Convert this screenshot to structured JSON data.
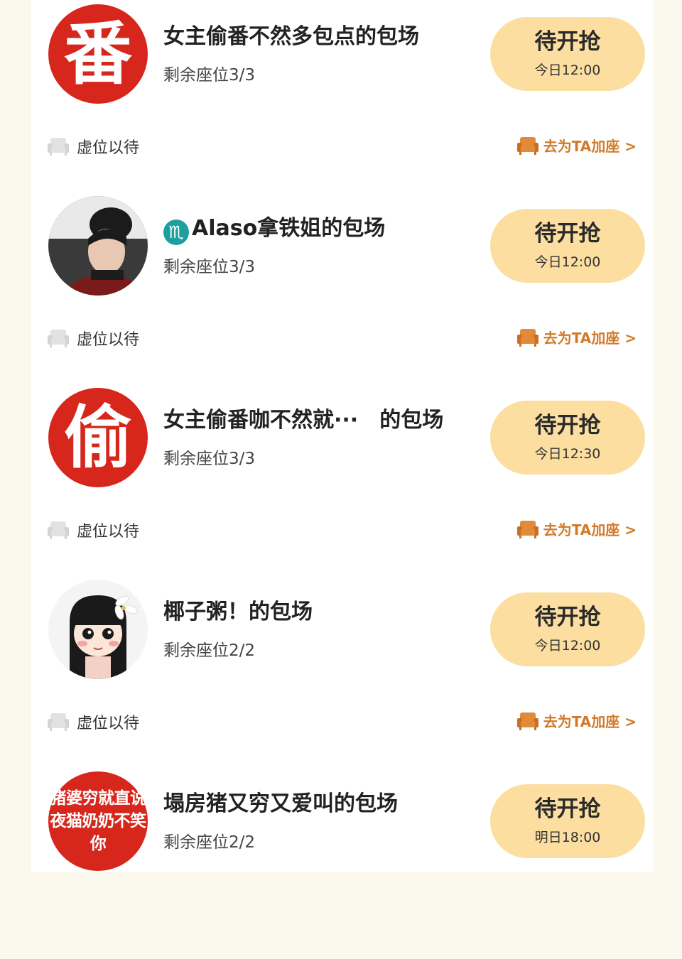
{
  "colors": {
    "accent_orange": "#d07a2a",
    "button_bg": "#fcdea0",
    "avatar_red": "#d7261c"
  },
  "sessions": [
    {
      "avatar_char": "番",
      "title": "女主偷番不然多包点的包场",
      "seats": "剩余座位3/3",
      "button_label": "待开抢",
      "button_time": "今日12:00",
      "vacant_label": "虚位以待",
      "add_label": "去为TA加座 >"
    },
    {
      "avatar_icon": "portrait-photo",
      "title_badge": "♏",
      "title": "Alaso拿铁姐的包场",
      "seats": "剩余座位3/3",
      "button_label": "待开抢",
      "button_time": "今日12:00",
      "vacant_label": "虚位以待",
      "add_label": "去为TA加座 >"
    },
    {
      "avatar_char": "偷",
      "title": "女主偷番咖不然就···　的包场",
      "seats": "剩余座位3/3",
      "button_label": "待开抢",
      "button_time": "今日12:30",
      "vacant_label": "虚位以待",
      "add_label": "去为TA加座 >"
    },
    {
      "avatar_icon": "cartoon-girl",
      "title": "椰子粥！的包场",
      "seats": "剩余座位2/2",
      "button_label": "待开抢",
      "button_time": "今日12:00",
      "vacant_label": "虚位以待",
      "add_label": "去为TA加座 >"
    },
    {
      "avatar_text_lines": [
        "猪婆穷就直说",
        "夜猫奶奶不笑你"
      ],
      "title": "塌房猪又穷又爱叫的包场",
      "seats": "剩余座位2/2",
      "button_label": "待开抢",
      "button_time": "明日18:00"
    }
  ]
}
